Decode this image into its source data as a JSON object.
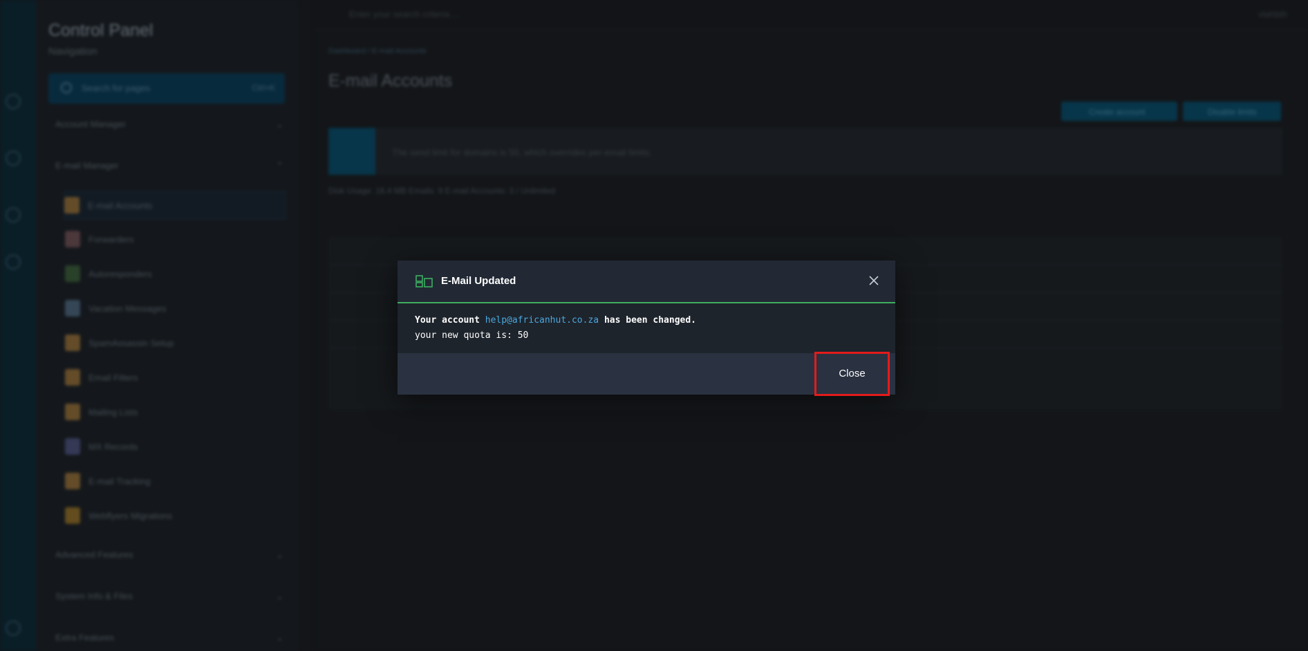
{
  "sidebar": {
    "title": "Control Panel",
    "subtitle": "Navigation",
    "search_placeholder": "Search for pages",
    "search_shortcut": "Ctrl+K",
    "sections": [
      {
        "label": "Account Manager"
      },
      {
        "label": "E-mail Manager"
      },
      {
        "label": "Advanced Features"
      },
      {
        "label": "System Info & Files"
      },
      {
        "label": "Extra Features"
      }
    ],
    "items": [
      {
        "label": "E-mail Accounts"
      },
      {
        "label": "Forwarders"
      },
      {
        "label": "Autoresponders"
      },
      {
        "label": "Vacation Messages"
      },
      {
        "label": "SpamAssassin Setup"
      },
      {
        "label": "Email Filters"
      },
      {
        "label": "Mailing Lists"
      },
      {
        "label": "MX Records"
      },
      {
        "label": "E-mail Tracking"
      },
      {
        "label": "Webflyers Migrations"
      }
    ]
  },
  "topbar": {
    "search_placeholder": "Enter your search criteria ...",
    "user": "vlahbth"
  },
  "page": {
    "breadcrumb": "Dashboard / E-mail Accounts",
    "title": "E-mail Accounts",
    "buttons": {
      "create": "Create account",
      "disable": "Disable limits"
    },
    "notice": "The send limit for domains is 50, which overrides per-email limits.",
    "stats": "Disk Usage: 16.4 MB   Emails: 9   E-mail Accounts: 3 / Unlimited"
  },
  "modal": {
    "title": "E-Mail Updated",
    "line1_prefix": "Your account ",
    "email": "help@africanhut.co.za",
    "line1_suffix": " has been changed.",
    "line2": "your new quota is: 50",
    "close_label": "Close",
    "accent_color": "#3fae5f",
    "highlight_color": "#e31b1b"
  }
}
